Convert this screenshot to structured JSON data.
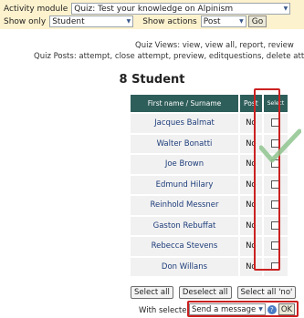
{
  "filters": {
    "activity_label": "Activity module",
    "activity_value": "Quiz: Test your knowledge on Alpinism",
    "show_only_label": "Show only",
    "show_only_value": "Student",
    "show_actions_label": "Show actions",
    "show_actions_value": "Post",
    "go_label": "Go"
  },
  "info": {
    "quiz_views": "Quiz Views: view, view all, report, review",
    "quiz_posts": "Quiz Posts: attempt, close attempt, preview, editquestions, delete attem"
  },
  "heading": "8 Student",
  "table": {
    "headers": {
      "name": "First name / Surname",
      "post": "Post",
      "select": "Select"
    },
    "rows": [
      {
        "name": "Jacques Balmat",
        "post": "No"
      },
      {
        "name": "Walter Bonatti",
        "post": "No"
      },
      {
        "name": "Joe Brown",
        "post": "No"
      },
      {
        "name": "Edmund Hilary",
        "post": "No"
      },
      {
        "name": "Reinhold Messner",
        "post": "No"
      },
      {
        "name": "Gaston Rebuffat",
        "post": "No"
      },
      {
        "name": "Rebecca Stevens",
        "post": "No"
      },
      {
        "name": "Don Willans",
        "post": "No"
      }
    ]
  },
  "buttons": {
    "select_all": "Select all",
    "deselect_all": "Deselect all",
    "select_all_no": "Select all 'no'"
  },
  "with_selected": {
    "label": "With selected users...",
    "action_value": "Send a message",
    "ok_label": "OK"
  },
  "colors": {
    "header_bg": "#2e5e5a",
    "highlight": "#cc2020",
    "checkmark": "#8fc48f",
    "topbar_bg": "#fdf2ce"
  }
}
